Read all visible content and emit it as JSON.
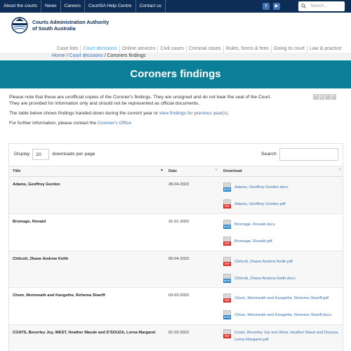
{
  "topnav": [
    "About the courts",
    "News",
    "Careers",
    "CourtSA Help Centre",
    "Contact us"
  ],
  "social": [
    {
      "name": "twitter",
      "glyph": "t",
      "color": "#3f73b5"
    },
    {
      "name": "youtube",
      "glyph": "▶",
      "color": "#3f73b5"
    }
  ],
  "search": {
    "placeholder": "Search..."
  },
  "logo": {
    "line1": "Courts Administration Authority",
    "line2": "of South Australia"
  },
  "mainnav": [
    {
      "label": "Case lists",
      "active": false
    },
    {
      "label": "Court decisions",
      "active": true
    },
    {
      "label": "Online services",
      "active": false
    },
    {
      "label": "Civil cases",
      "active": false
    },
    {
      "label": "Criminal cases",
      "active": false
    },
    {
      "label": "Rules, forms & fees",
      "active": false
    },
    {
      "label": "Going to court",
      "active": false
    },
    {
      "label": "Law & practice",
      "active": false
    }
  ],
  "breadcrumb": {
    "home": "Home",
    "sep1": " / ",
    "section": "Court decisions",
    "sep2": " / ",
    "current": "Coroners findings"
  },
  "page": {
    "title": "Coroners findings"
  },
  "intro": {
    "p1": "Please note that these are unofficial copies of the Coroner's findings. They are unsigned and do not bear the seal of the Court. They are provided for information only and should not be represented as official documents.",
    "p2_before": "The table below shows findings handed down during the current year or ",
    "p2_link": "view findings for previous year(s)",
    "p2_after": ".",
    "p3_before": "For further information, please contact the ",
    "p3_link": "Coroner's Office"
  },
  "table_controls": {
    "display_label": "Display",
    "per_page": "20",
    "per_page_suffix": "downloads per page",
    "search_label": "Search:"
  },
  "columns": {
    "title": "Title",
    "date": "Date",
    "download": "Download"
  },
  "rows": [
    {
      "title": "Adams, Geoffrey Gordon",
      "date": "28-04-2023",
      "files": [
        {
          "type": "doc",
          "name": "Adams, Geoffrey Gordon.docx"
        },
        {
          "type": "pdf",
          "name": "Adams, Geoffrey Gordon.pdf"
        }
      ]
    },
    {
      "title": "Bromage, Ronald",
      "date": "31-01-2023",
      "files": [
        {
          "type": "doc",
          "name": "Bromage, Ronald.docx"
        },
        {
          "type": "pdf",
          "name": "Bromage, Ronald.pdf"
        }
      ]
    },
    {
      "title": "Chilcott, Zhane Andrew Keith",
      "date": "06-04-2023",
      "files": [
        {
          "type": "pdf",
          "name": "Chilcott, Zhane Andrew Keith.pdf"
        },
        {
          "type": "doc",
          "name": "Chilcott, Zhane Andrew Keith.docx"
        }
      ]
    },
    {
      "title": "Chum, Monineath and Kangethe, Rehema Shariff",
      "date": "03-03-2023",
      "files": [
        {
          "type": "pdf",
          "name": "Chum, Monineath and Kangethe, Rehema Shariff.pdf"
        },
        {
          "type": "doc",
          "name": "Chum, Monineath and Kangethe, Rehema Shariff.docx"
        }
      ]
    },
    {
      "title": "COATS, Beverley Joy, WEST, Heather Maude and D'SOUZA, Lorna Margaret",
      "date": "01-03-2023",
      "files": [
        {
          "type": "pdf",
          "name": "Coats, Beverley Joy and West, Heather Maud and Dsouza, Lorna Margaret.pdf"
        }
      ]
    }
  ],
  "file_tags": {
    "pdf": "PDF",
    "doc": "DOCX"
  }
}
